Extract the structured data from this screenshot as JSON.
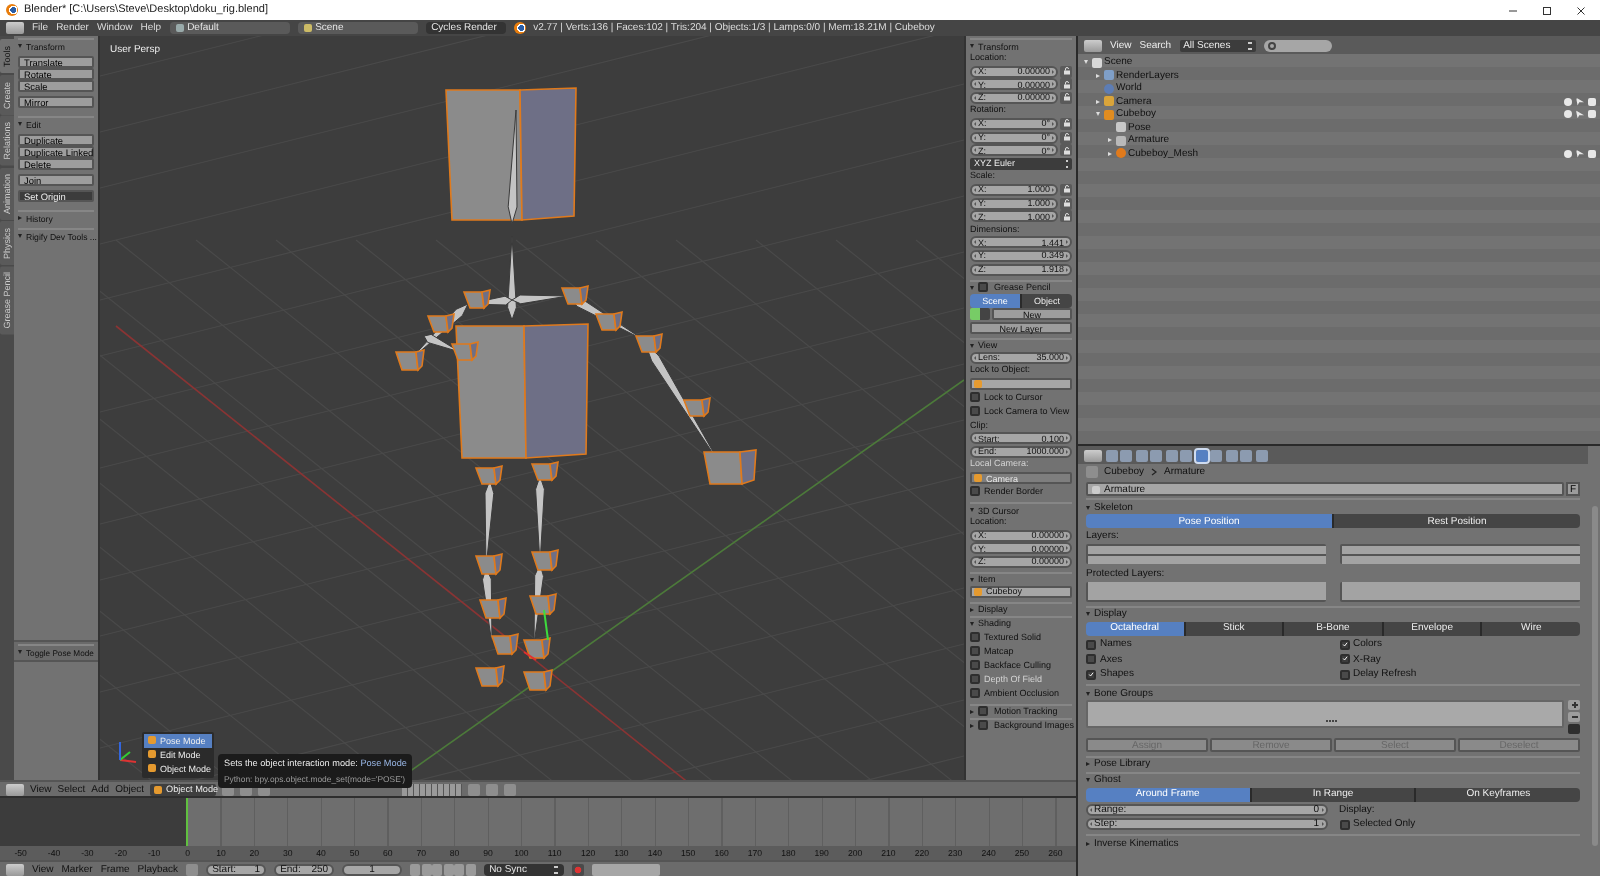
{
  "window": {
    "title": "Blender* [C:\\Users\\Steve\\Desktop\\doku_rig.blend]"
  },
  "info_header": {
    "menus": [
      "File",
      "Render",
      "Window",
      "Help"
    ],
    "layout": "Default",
    "scene": "Scene",
    "engine": "Cycles Render",
    "stats": "v2.77 | Verts:136 | Faces:102 | Tris:204 | Objects:1/3 | Lamps:0/0 | Mem:18.21M | Cubeboy"
  },
  "tool_tabs": [
    {
      "label": "Tools",
      "selected": true
    },
    {
      "label": "Create",
      "selected": false
    },
    {
      "label": "Relations",
      "selected": false
    },
    {
      "label": "Animation",
      "selected": false
    },
    {
      "label": "Physics",
      "selected": false
    },
    {
      "label": "Grease Pencil",
      "selected": false
    }
  ],
  "tool_shelf": {
    "panels": [
      {
        "title": "Transform",
        "expanded": true,
        "groups": [
          [
            {
              "label": "Translate",
              "kind": "button"
            },
            {
              "label": "Rotate",
              "kind": "button"
            },
            {
              "label": "Scale",
              "kind": "button"
            }
          ],
          [
            {
              "label": "Mirror",
              "kind": "button"
            }
          ]
        ]
      },
      {
        "title": "Edit",
        "expanded": true,
        "groups": [
          [
            {
              "label": "Duplicate",
              "kind": "button"
            },
            {
              "label": "Duplicate Linked",
              "kind": "button"
            },
            {
              "label": "Delete",
              "kind": "button"
            }
          ],
          [
            {
              "label": "Join",
              "kind": "button"
            }
          ],
          [
            {
              "label": "Set Origin",
              "kind": "menu"
            }
          ]
        ]
      },
      {
        "title": "History",
        "expanded": false
      },
      {
        "title": "Rigify Dev Tools ...",
        "expanded": true
      }
    ],
    "last_operator": {
      "title": "Toggle Pose Mode",
      "expanded": true
    }
  },
  "viewport": {
    "label": "User Persp",
    "header": {
      "menus": [
        "View",
        "Select",
        "Add",
        "Object"
      ],
      "mode": "Object Mode"
    },
    "mode_menu": [
      {
        "label": "Pose Mode",
        "selected": true
      },
      {
        "label": "Edit Mode",
        "selected": false
      },
      {
        "label": "Object Mode",
        "selected": false
      }
    ],
    "tooltip": {
      "text": "Sets the object interaction mode:",
      "value": "Pose Mode",
      "python": "Python: bpy.ops.object.mode_set(mode='POSE')"
    }
  },
  "n_panel": {
    "panels": [
      {
        "title": "Transform",
        "expanded": true,
        "rows": [
          {
            "kind": "label",
            "text": "Location:"
          },
          {
            "kind": "field",
            "label": "X:",
            "value": "0.00000",
            "lock": true
          },
          {
            "kind": "field",
            "label": "Y:",
            "value": "0.00000",
            "lock": true
          },
          {
            "kind": "field",
            "label": "Z:",
            "value": "0.00000",
            "lock": true
          },
          {
            "kind": "label",
            "text": "Rotation:"
          },
          {
            "kind": "field",
            "label": "X:",
            "value": "0°",
            "lock": true
          },
          {
            "kind": "field",
            "label": "Y:",
            "value": "0°",
            "lock": true
          },
          {
            "kind": "field",
            "label": "Z:",
            "value": "0°",
            "lock": true
          },
          {
            "kind": "dropdown",
            "value": "XYZ Euler"
          },
          {
            "kind": "label",
            "text": "Scale:"
          },
          {
            "kind": "field",
            "label": "X:",
            "value": "1.000",
            "lock": true
          },
          {
            "kind": "field",
            "label": "Y:",
            "value": "1.000",
            "lock": true
          },
          {
            "kind": "field",
            "label": "Z:",
            "value": "1.000",
            "lock": true
          },
          {
            "kind": "label",
            "text": "Dimensions:"
          },
          {
            "kind": "field",
            "label": "X:",
            "value": "1.441",
            "lock": false
          },
          {
            "kind": "field",
            "label": "Y:",
            "value": "0.349",
            "lock": false
          },
          {
            "kind": "field",
            "label": "Z:",
            "value": "1.918",
            "lock": false
          }
        ]
      },
      {
        "title": "Grease Pencil",
        "expanded": true,
        "checkbox": false,
        "rows": [
          {
            "kind": "tabs",
            "items": [
              {
                "label": "Scene",
                "selected": true
              },
              {
                "label": "Object",
                "selected": false
              }
            ]
          },
          {
            "kind": "new_button",
            "label": "New"
          },
          {
            "kind": "button",
            "label": "New Layer"
          }
        ]
      },
      {
        "title": "View",
        "expanded": true,
        "rows": [
          {
            "kind": "field",
            "label": "Lens:",
            "value": "35.000",
            "lock": false
          },
          {
            "kind": "label",
            "text": "Lock to Object:"
          },
          {
            "kind": "object_field",
            "disabled": false
          },
          {
            "kind": "checkbox",
            "label": "Lock to Cursor",
            "checked": false,
            "disabled": false
          },
          {
            "kind": "checkbox",
            "label": "Lock Camera to View",
            "checked": false,
            "disabled": false
          },
          {
            "kind": "label",
            "text": "Clip:"
          },
          {
            "kind": "field",
            "label": "Start:",
            "value": "0.100",
            "lock": false
          },
          {
            "kind": "field",
            "label": "End:",
            "value": "1000.000",
            "lock": false
          },
          {
            "kind": "label",
            "text": "Local Camera:",
            "disabled": true
          },
          {
            "kind": "object_field",
            "value": "Camera",
            "disabled": true
          },
          {
            "kind": "checkbox",
            "label": "Render Border",
            "checked": false,
            "disabled": false
          }
        ]
      },
      {
        "title": "3D Cursor",
        "expanded": true,
        "rows": [
          {
            "kind": "label",
            "text": "Location:"
          },
          {
            "kind": "field",
            "label": "X:",
            "value": "0.00000",
            "lock": false
          },
          {
            "kind": "field",
            "label": "Y:",
            "value": "0.00000",
            "lock": false
          },
          {
            "kind": "field",
            "label": "Z:",
            "value": "0.00000",
            "lock": false
          }
        ]
      },
      {
        "title": "Item",
        "expanded": true,
        "rows": [
          {
            "kind": "object_field",
            "value": "Cubeboy",
            "disabled": false
          }
        ]
      },
      {
        "title": "Display",
        "expanded": false
      },
      {
        "title": "Shading",
        "expanded": true,
        "rows": [
          {
            "kind": "checkbox",
            "label": "Textured Solid",
            "checked": false,
            "disabled": false
          },
          {
            "kind": "checkbox",
            "label": "Matcap",
            "checked": false,
            "disabled": false
          },
          {
            "kind": "checkbox",
            "label": "Backface Culling",
            "checked": false,
            "disabled": false
          },
          {
            "kind": "checkbox",
            "label": "Depth Of Field",
            "checked": false,
            "disabled": true
          },
          {
            "kind": "checkbox",
            "label": "Ambient Occlusion",
            "checked": false,
            "disabled": false
          }
        ]
      },
      {
        "title": "Motion Tracking",
        "expanded": false,
        "checkbox": false
      },
      {
        "title": "Background Images",
        "expanded": false,
        "checkbox": false
      }
    ]
  },
  "outliner": {
    "header": {
      "menus": [
        "View",
        "Search"
      ],
      "filter": "All Scenes"
    },
    "tree": [
      {
        "label": "Scene",
        "kind": "scene",
        "expanded": true,
        "children": [
          {
            "label": "RenderLayers",
            "kind": "render_layers",
            "expanded": false
          },
          {
            "label": "World",
            "kind": "world"
          },
          {
            "label": "Camera",
            "kind": "camera",
            "expanded": false,
            "restrict": true
          },
          {
            "label": "Cubeboy",
            "kind": "armature_object",
            "expanded": true,
            "restrict": true,
            "children": [
              {
                "label": "Pose",
                "kind": "pose"
              },
              {
                "label": "Armature",
                "kind": "armature",
                "expanded": false
              },
              {
                "label": "Cubeboy_Mesh",
                "kind": "mesh_object",
                "expanded": false,
                "restrict": true
              }
            ]
          }
        ]
      }
    ]
  },
  "properties": {
    "tabs": [
      {
        "selected": false
      },
      {
        "selected": false
      },
      {
        "selected": false
      },
      {
        "selected": false
      },
      {
        "selected": false
      },
      {
        "selected": false
      },
      {
        "selected": true
      },
      {
        "selected": false
      },
      {
        "selected": false
      },
      {
        "selected": false
      },
      {
        "selected": false
      }
    ],
    "breadcrumb": [
      "Cubeboy",
      "Armature"
    ],
    "datablock": {
      "value": "Armature",
      "fake_user": "F"
    },
    "panels": [
      {
        "title": "Skeleton",
        "expanded": true,
        "rows": [
          {
            "kind": "tabs",
            "items": [
              {
                "label": "Pose Position",
                "selected": true
              },
              {
                "label": "Rest Position",
                "selected": false
              }
            ]
          },
          {
            "kind": "label",
            "text": "Layers:"
          },
          {
            "kind": "layers"
          },
          {
            "kind": "label",
            "text": "Protected Layers:"
          },
          {
            "kind": "layers"
          }
        ]
      },
      {
        "title": "Display",
        "expanded": true,
        "rows": [
          {
            "kind": "tabs",
            "items": [
              {
                "label": "Octahedral",
                "selected": true
              },
              {
                "label": "Stick",
                "selected": false
              },
              {
                "label": "B-Bone",
                "selected": false
              },
              {
                "label": "Envelope",
                "selected": false
              },
              {
                "label": "Wire",
                "selected": false
              }
            ]
          },
          {
            "kind": "split",
            "columns": [
              [
                {
                  "kind": "checkbox",
                  "label": "Names",
                  "checked": false,
                  "disabled": false
                },
                {
                  "kind": "checkbox",
                  "label": "Axes",
                  "checked": false,
                  "disabled": false
                },
                {
                  "kind": "checkbox",
                  "label": "Shapes",
                  "checked": true,
                  "disabled": false
                }
              ],
              [
                {
                  "kind": "checkbox",
                  "label": "Colors",
                  "checked": true,
                  "disabled": false
                },
                {
                  "kind": "checkbox",
                  "label": "X-Ray",
                  "checked": true,
                  "disabled": false
                },
                {
                  "kind": "checkbox",
                  "label": "Delay Refresh",
                  "checked": false,
                  "disabled": false
                }
              ]
            ]
          }
        ]
      },
      {
        "title": "Bone Groups",
        "expanded": true,
        "rows": [
          {
            "kind": "list"
          },
          {
            "kind": "button_row",
            "items": [
              {
                "label": "Assign",
                "disabled": true
              },
              {
                "label": "Remove",
                "disabled": true
              },
              {
                "label": "Select",
                "disabled": true
              },
              {
                "label": "Deselect",
                "disabled": true
              }
            ]
          }
        ]
      },
      {
        "title": "Pose Library",
        "expanded": false
      },
      {
        "title": "Ghost",
        "expanded": true,
        "rows": [
          {
            "kind": "tabs",
            "items": [
              {
                "label": "Around Frame",
                "selected": true
              },
              {
                "label": "In Range",
                "selected": false
              },
              {
                "label": "On Keyframes",
                "selected": false
              }
            ]
          },
          {
            "kind": "split",
            "columns": [
              [
                {
                  "kind": "field",
                  "label": "Range:",
                  "value": "0",
                  "lock": false
                },
                {
                  "kind": "field",
                  "label": "Step:",
                  "value": "1",
                  "lock": false
                }
              ],
              [
                {
                  "kind": "label",
                  "text": "Display:"
                },
                {
                  "kind": "checkbox",
                  "label": "Selected Only",
                  "checked": false,
                  "disabled": false
                }
              ]
            ]
          }
        ]
      },
      {
        "title": "Inverse Kinematics",
        "expanded": false
      }
    ]
  },
  "timeline": {
    "ruler": [
      "-50",
      "-40",
      "-30",
      "-20",
      "-10",
      "0",
      "10",
      "20",
      "30",
      "40",
      "50",
      "60",
      "70",
      "80",
      "90",
      "100",
      "110",
      "120",
      "130",
      "140",
      "150",
      "160",
      "170",
      "180",
      "190",
      "200",
      "210",
      "220",
      "230",
      "240",
      "250",
      "260"
    ],
    "header": {
      "menus": [
        "View",
        "Marker",
        "Frame",
        "Playback"
      ],
      "start": {
        "label": "Start:",
        "value": "1"
      },
      "end": {
        "label": "End:",
        "value": "250"
      },
      "current": "1",
      "sync": "No Sync"
    }
  }
}
